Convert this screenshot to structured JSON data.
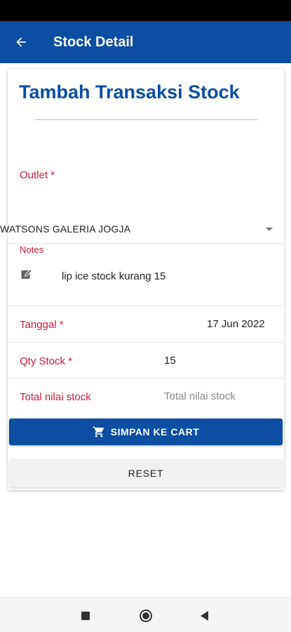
{
  "app_bar": {
    "title": "Stock Detail"
  },
  "form": {
    "heading": "Tambah Transaksi Stock",
    "outlet": {
      "label": "Outlet *",
      "selected": "WATSONS GALERIA JOGJA"
    },
    "notes": {
      "label": "Notes",
      "value": "lip ice stock kurang 15"
    },
    "tanggal": {
      "label": "Tanggal *",
      "value": "17 Jun 2022"
    },
    "qty": {
      "label": "Qty Stock *",
      "value": "15"
    },
    "total": {
      "label": "Total nilai stock",
      "placeholder": "Total nilai stock"
    },
    "save_button": "SIMPAN KE CART",
    "reset_button": "RESET"
  },
  "colors": {
    "primary": "#0b4ea2",
    "label_red": "#d11a3e"
  },
  "icons": [
    "back-arrow-icon",
    "edit-note-icon",
    "cart-icon",
    "dropdown-arrow-icon",
    "nav-recent-icon",
    "nav-home-icon",
    "nav-back-icon"
  ]
}
